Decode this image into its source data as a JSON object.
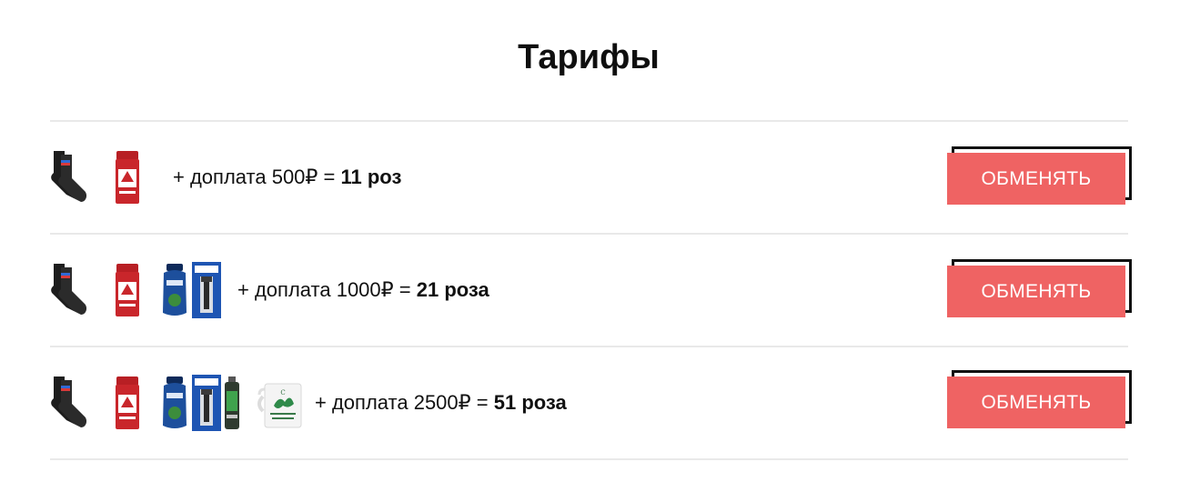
{
  "page": {
    "title": "Тарифы"
  },
  "tariffs": [
    {
      "text_prefix": "+ доплата 500₽ = ",
      "text_bold": "11 роз",
      "button_label": "ОБМЕНЯТЬ",
      "products": [
        "socks-icon",
        "deodorant-icon"
      ]
    },
    {
      "text_prefix": "+ доплата 1000₽ = ",
      "text_bold": "21 роза",
      "button_label": "ОБМЕНЯТЬ",
      "products": [
        "socks-icon",
        "deodorant-icon",
        "shower-gel-icon",
        "razor-pack-icon"
      ]
    },
    {
      "text_prefix": "+ доплата 2500₽ = ",
      "text_bold": "51 роза",
      "button_label": "ОБМЕНЯТЬ",
      "products": [
        "socks-icon",
        "deodorant-icon",
        "shower-gel-icon",
        "razor-pack-icon",
        "shaving-foam-icon",
        "mug-icon"
      ]
    }
  ],
  "colors": {
    "button_bg": "#ef6363",
    "button_text": "#ffffff",
    "button_outline": "#111111",
    "divider": "#e9e9e9",
    "text": "#111111"
  }
}
